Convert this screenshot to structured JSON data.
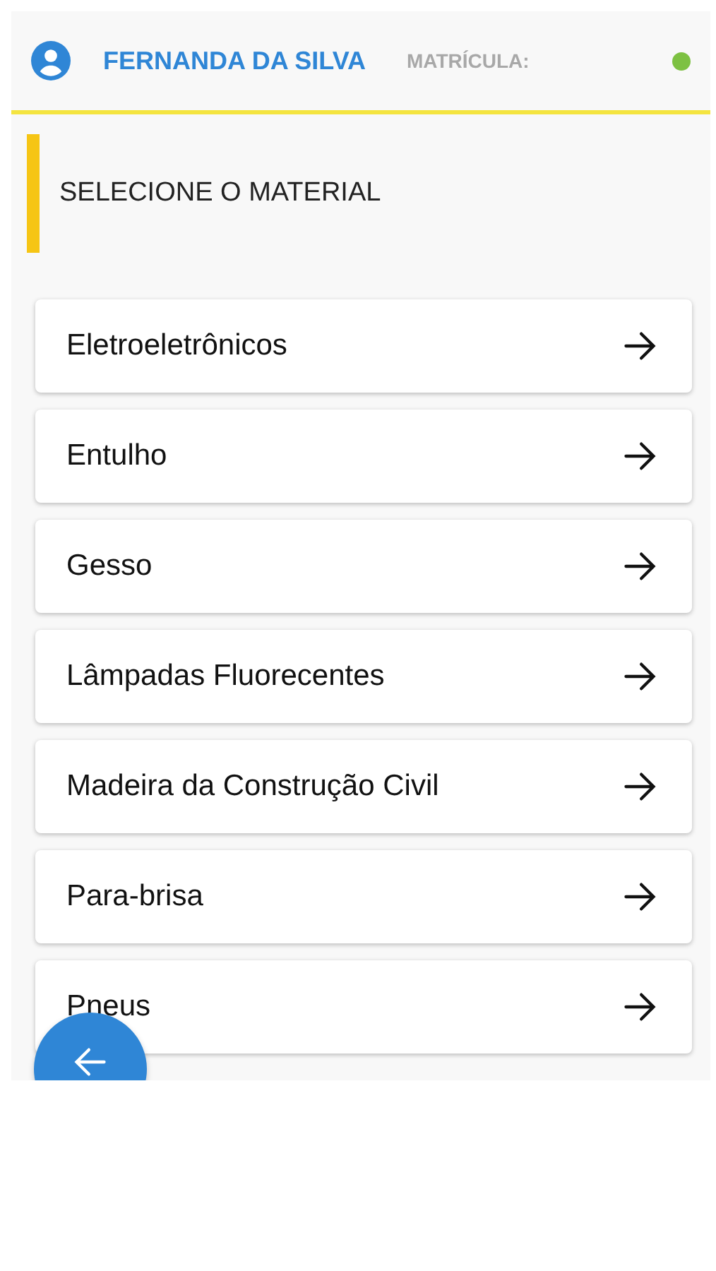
{
  "header": {
    "user_name": "FERNANDA DA SILVA",
    "registration_label": "MATRÍCULA:",
    "online": true
  },
  "section": {
    "title": "SELECIONE O MATERIAL"
  },
  "materials": [
    {
      "label": "Eletroeletrônicos"
    },
    {
      "label": "Entulho"
    },
    {
      "label": "Gesso"
    },
    {
      "label": "Lâmpadas Fluorecentes"
    },
    {
      "label": "Madeira da Construção Civil"
    },
    {
      "label": "Para-brisa"
    },
    {
      "label": "Pneus"
    }
  ]
}
